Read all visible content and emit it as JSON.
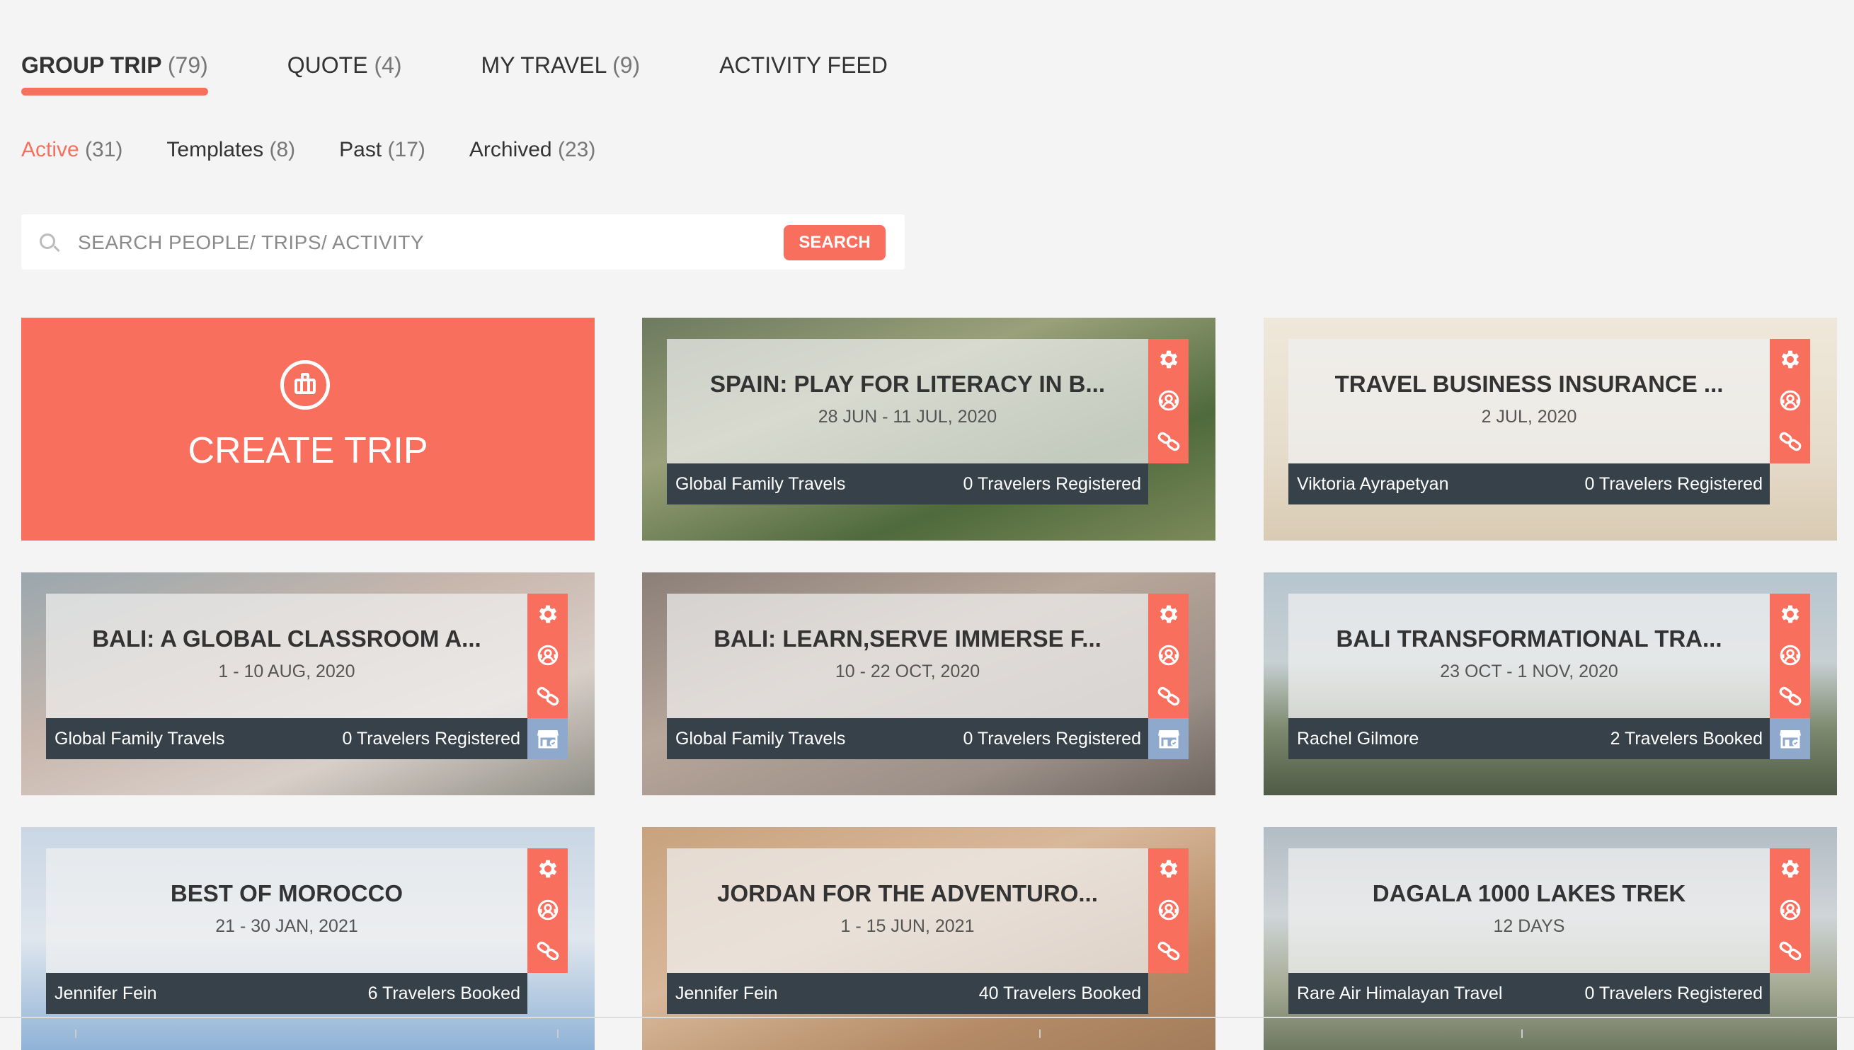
{
  "main_tabs": [
    {
      "label": "GROUP TRIP",
      "count": "(79)",
      "active": true
    },
    {
      "label": "QUOTE",
      "count": "(4)",
      "active": false
    },
    {
      "label": "MY TRAVEL",
      "count": "(9)",
      "active": false
    },
    {
      "label": "ACTIVITY FEED",
      "count": "",
      "active": false
    }
  ],
  "sub_tabs": [
    {
      "label": "Active",
      "count": "(31)",
      "active": true
    },
    {
      "label": "Templates",
      "count": "(8)",
      "active": false
    },
    {
      "label": "Past",
      "count": "(17)",
      "active": false
    },
    {
      "label": "Archived",
      "count": "(23)",
      "active": false
    }
  ],
  "search": {
    "placeholder": "SEARCH PEOPLE/ TRIPS/ ACTIVITY",
    "button": "SEARCH"
  },
  "create_trip": {
    "label": "CREATE TRIP",
    "icon": "briefcase-icon"
  },
  "colors": {
    "accent": "#f86f5e",
    "footer": "#37414a",
    "store": "#8ea9cc"
  },
  "trips": [
    {
      "title": "SPAIN: PLAY FOR LITERACY IN B...",
      "date": "28 JUN - 11 JUL, 2020",
      "org": "Global Family Travels",
      "travelers": "0 Travelers Registered",
      "store": false
    },
    {
      "title": "TRAVEL BUSINESS INSURANCE ...",
      "date": "2 JUL, 2020",
      "org": "Viktoria Ayrapetyan",
      "travelers": "0 Travelers Registered",
      "store": false
    },
    {
      "title": "BALI: A GLOBAL CLASSROOM A...",
      "date": "1 - 10 AUG, 2020",
      "org": "Global Family Travels",
      "travelers": "0 Travelers Registered",
      "store": true
    },
    {
      "title": "BALI: LEARN,SERVE IMMERSE F...",
      "date": "10 - 22 OCT, 2020",
      "org": "Global Family Travels",
      "travelers": "0 Travelers Registered",
      "store": true
    },
    {
      "title": "BALI TRANSFORMATIONAL TRA...",
      "date": "23 OCT - 1 NOV, 2020",
      "org": "Rachel Gilmore",
      "travelers": "2 Travelers Booked",
      "store": true
    },
    {
      "title": "BEST OF MOROCCO",
      "date": "21 - 30 JAN, 2021",
      "org": "Jennifer Fein",
      "travelers": "6 Travelers Booked",
      "store": false
    },
    {
      "title": "JORDAN FOR THE ADVENTURO...",
      "date": "1 - 15 JUN, 2021",
      "org": "Jennifer Fein",
      "travelers": "40 Travelers Booked",
      "store": false
    },
    {
      "title": "DAGALA 1000 LAKES TREK",
      "date": "12 DAYS",
      "org": "Rare Air Himalayan Travel",
      "travelers": "0 Travelers Registered",
      "store": false
    }
  ]
}
